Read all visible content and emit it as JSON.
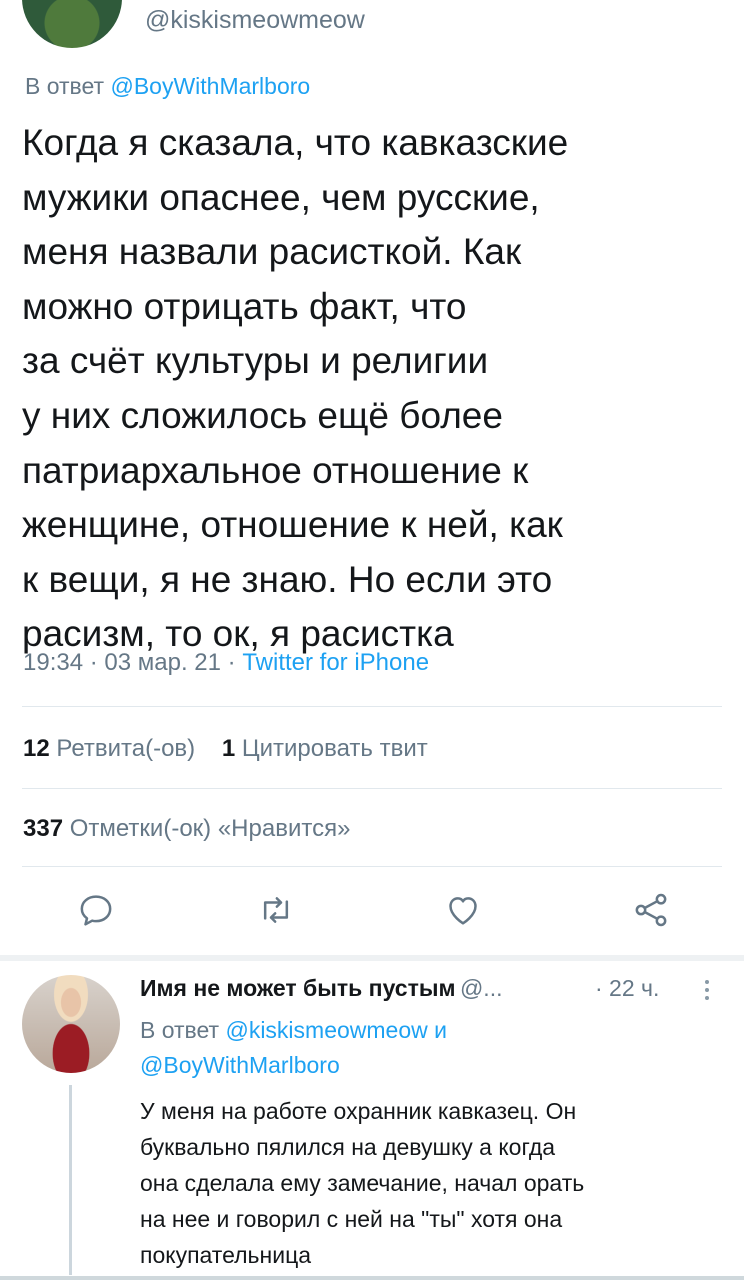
{
  "tweet": {
    "handle": "@kiskismeowmeow",
    "reply_to_prefix": "В ответ",
    "reply_to_handle": "@BoyWithMarlboro",
    "text": "Когда я сказала, что кавказские\nмужики опаснее, чем русские,\nменя назвали расисткой. Как\nможно отрицать факт, что\nза счёт культуры и религии\nу них сложилось ещё более\nпатриархальное отношение к\nженщине, отношение к ней, как\nк вещи, я не знаю. Но если это\nрасизм, то ок, я расистка",
    "timestamp": "19:34 · 03 мар. 21 ·",
    "source": "Twitter for iPhone"
  },
  "stats": {
    "retweets_count": "12",
    "retweets_label": "Ретвита(-ов)",
    "quotes_count": "1",
    "quotes_label": "Цитировать твит",
    "likes_count": "337",
    "likes_label": "Отметки(-ок) «Нравится»"
  },
  "actions": {
    "icons": [
      "reply-icon",
      "retweet-icon",
      "like-icon",
      "share-icon"
    ]
  },
  "reply": {
    "name": "Имя не может быть пустым",
    "handle": "@...",
    "time": "· 22 ч.",
    "reply_to_prefix": "В ответ",
    "reply_to_handle_1": "@kiskismeowmeow",
    "reply_to_and": "и",
    "reply_to_handle_2": "@BoyWithMarlboro",
    "text": "У меня на работе охранник кавказец. Он\nбуквально пялился на девушку  а когда\nона сделала ему замечание, начал орать\nна нее и говорил с ней на \"ты\" хотя она\nпокупательница"
  },
  "colors": {
    "accent": "#1da1f2",
    "secondary_text": "#657786",
    "primary_text": "#14171a",
    "divider": "#e1e8ed"
  }
}
